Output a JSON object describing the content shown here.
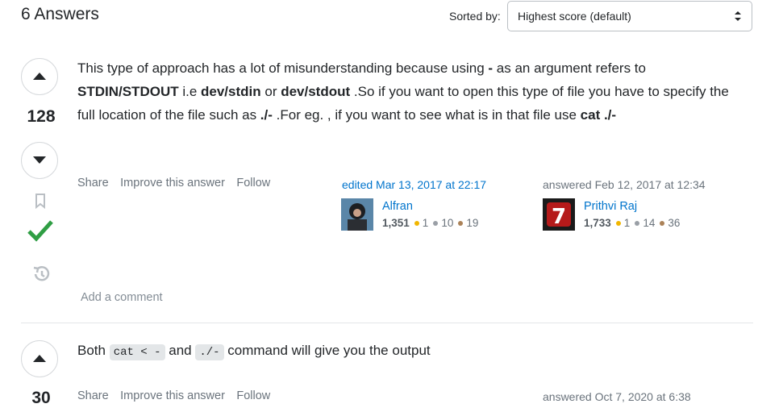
{
  "header": {
    "title": "6 Answers",
    "sort_label": "Sorted by:",
    "sort_value": "Highest score (default)"
  },
  "answer1": {
    "score": "128",
    "text_parts": [
      "This type of approach has a lot of misunderstanding because using ",
      "-",
      " as an argument refers to ",
      "STDIN/STDOUT",
      " i.e ",
      "dev/stdin",
      " or ",
      "dev/stdout",
      " .So if you want to open this type of file you have to specify the full location of the file such as ",
      "./-",
      " .For eg. , if you want to see what is in that file use ",
      "cat ./-"
    ],
    "menu": {
      "share": "Share",
      "improve": "Improve this answer",
      "follow": "Follow"
    },
    "edited": {
      "label": "edited Mar 13, 2017 at 22:17",
      "user": "Alfran",
      "rep": "1,351",
      "gold": "1",
      "silver": "10",
      "bronze": "19"
    },
    "answered": {
      "label": "answered Feb 12, 2017 at 12:34",
      "user": "Prithvi Raj",
      "rep": "1,733",
      "gold": "1",
      "silver": "14",
      "bronze": "36"
    },
    "add_comment": "Add a comment"
  },
  "answer2": {
    "score": "30",
    "text_pre": "Both ",
    "code1": "cat < -",
    "text_mid": " and ",
    "code2": "./-",
    "text_post": " command will give you the output",
    "menu": {
      "share": "Share",
      "improve": "Improve this answer",
      "follow": "Follow"
    },
    "answered": {
      "label": "answered Oct 7, 2020 at 6:38"
    }
  },
  "colors": {
    "accent": "#0074cc",
    "accepted": "#2f9e44"
  }
}
